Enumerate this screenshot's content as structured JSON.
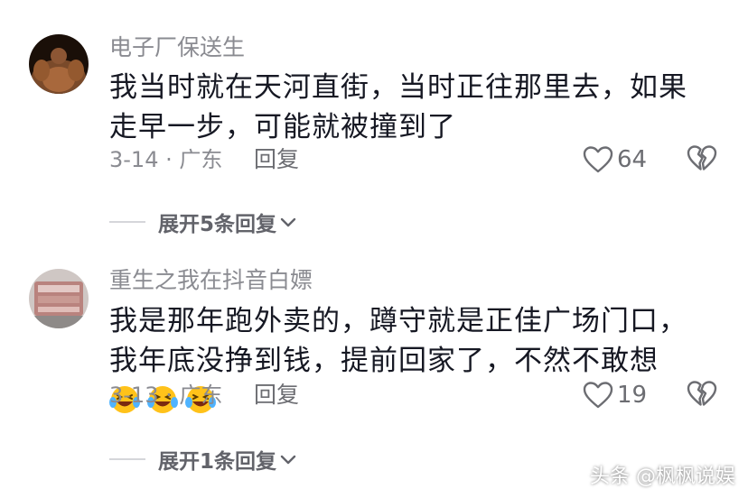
{
  "comments": [
    {
      "username": "电子厂保送生",
      "text": "我当时就在天河直街，当时正往那里去，如果走早一步，可能就被撞到了",
      "meta": "3-14 · 广东",
      "reply_label": "回复",
      "likes": "64",
      "expand_label": "展开5条回复"
    },
    {
      "username": "重生之我在抖音白嫖",
      "text": "我是那年跑外卖的，蹲守就是正佳广场门口，我年底没挣到钱，提前回家了，不然不敢想",
      "meta": "3-13 · 广东",
      "reply_label": "回复",
      "likes": "19",
      "expand_label": "展开1条回复"
    }
  ],
  "watermark": "头条 @枫枫说娱",
  "icons": {
    "like": "heart-outline-icon",
    "dislike": "broken-heart-icon",
    "expand": "chevron-down-icon",
    "emoji": "laughing-tears-emoji"
  }
}
